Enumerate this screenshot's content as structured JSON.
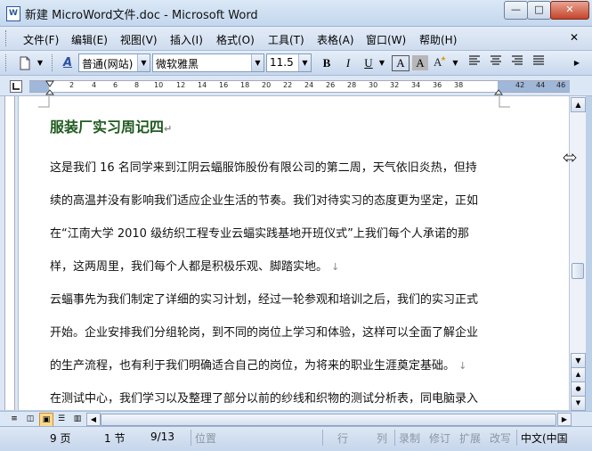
{
  "window": {
    "title": "新建 MicroWord文件.doc - Microsoft Word",
    "app_icon_letter": "W",
    "minimize_glyph": "—",
    "maximize_glyph": "□",
    "close_glyph": "✕"
  },
  "menubar": {
    "items": [
      "文件(F)",
      "编辑(E)",
      "视图(V)",
      "插入(I)",
      "格式(O)",
      "工具(T)",
      "表格(A)",
      "窗口(W)",
      "帮助(H)"
    ],
    "close_glyph": "✕"
  },
  "toolbar": {
    "style_value": "普通(网站)",
    "font_value": "微软雅黑",
    "size_value": "11.5",
    "bold_label": "B",
    "italic_label": "I",
    "underline_label": "U",
    "font_color_label": "A",
    "char_border_label": "A",
    "highlight_label": "A",
    "style_icon_label": "A"
  },
  "ruler": {
    "ticks": [
      "2",
      "4",
      "6",
      "8",
      "10",
      "12",
      "14",
      "16",
      "18",
      "20",
      "22",
      "24",
      "26",
      "28",
      "30",
      "32",
      "34",
      "36",
      "38",
      "42",
      "44",
      "46"
    ]
  },
  "document": {
    "title": "服装厂实习周记四",
    "title_mark": "↵",
    "lines": [
      {
        "text": "这是我们 16 名同学来到江阴云蝠服饰股份有限公司的第二周，天气依旧炎热，但持",
        "mark": ""
      },
      {
        "text": "续的高温并没有影响我们适应企业生活的节奏。我们对待实习的态度更为坚定，正如",
        "mark": ""
      },
      {
        "text": "在“江南大学 2010 级纺织工程专业云蝠实践基地开班仪式”上我们每个人承诺的那",
        "mark": ""
      },
      {
        "text": "样，这两周里，我们每个人都是积极乐观、脚踏实地。",
        "mark": "↓"
      },
      {
        "text": "云蝠事先为我们制定了详细的实习计划，经过一轮参观和培训之后，我们的实习正式",
        "mark": ""
      },
      {
        "text": "开始。企业安排我们分组轮岗，到不同的岗位上学习和体验，这样可以全面了解企业",
        "mark": ""
      },
      {
        "text": "的生产流程，也有利于我们明确适合自己的岗位，为将来的职业生涯奠定基础。",
        "mark": "↓"
      },
      {
        "text": "在测试中心，我们学习以及整理了部分以前的纱线和织物的测试分析表，同电脑录入",
        "mark": ""
      }
    ]
  },
  "statusbar": {
    "page": "9 页",
    "section": "1 节",
    "page_of": "9/13",
    "position": "位置",
    "line": "行",
    "column": "列",
    "rec": "录制",
    "trk": "修订",
    "ext": "扩展",
    "ovr": "改写",
    "lang": "中文(中国"
  },
  "colors": {
    "title_green": "#1f5a1f",
    "chrome_blue": "#c7d7ec",
    "close_red": "#c6442c"
  }
}
